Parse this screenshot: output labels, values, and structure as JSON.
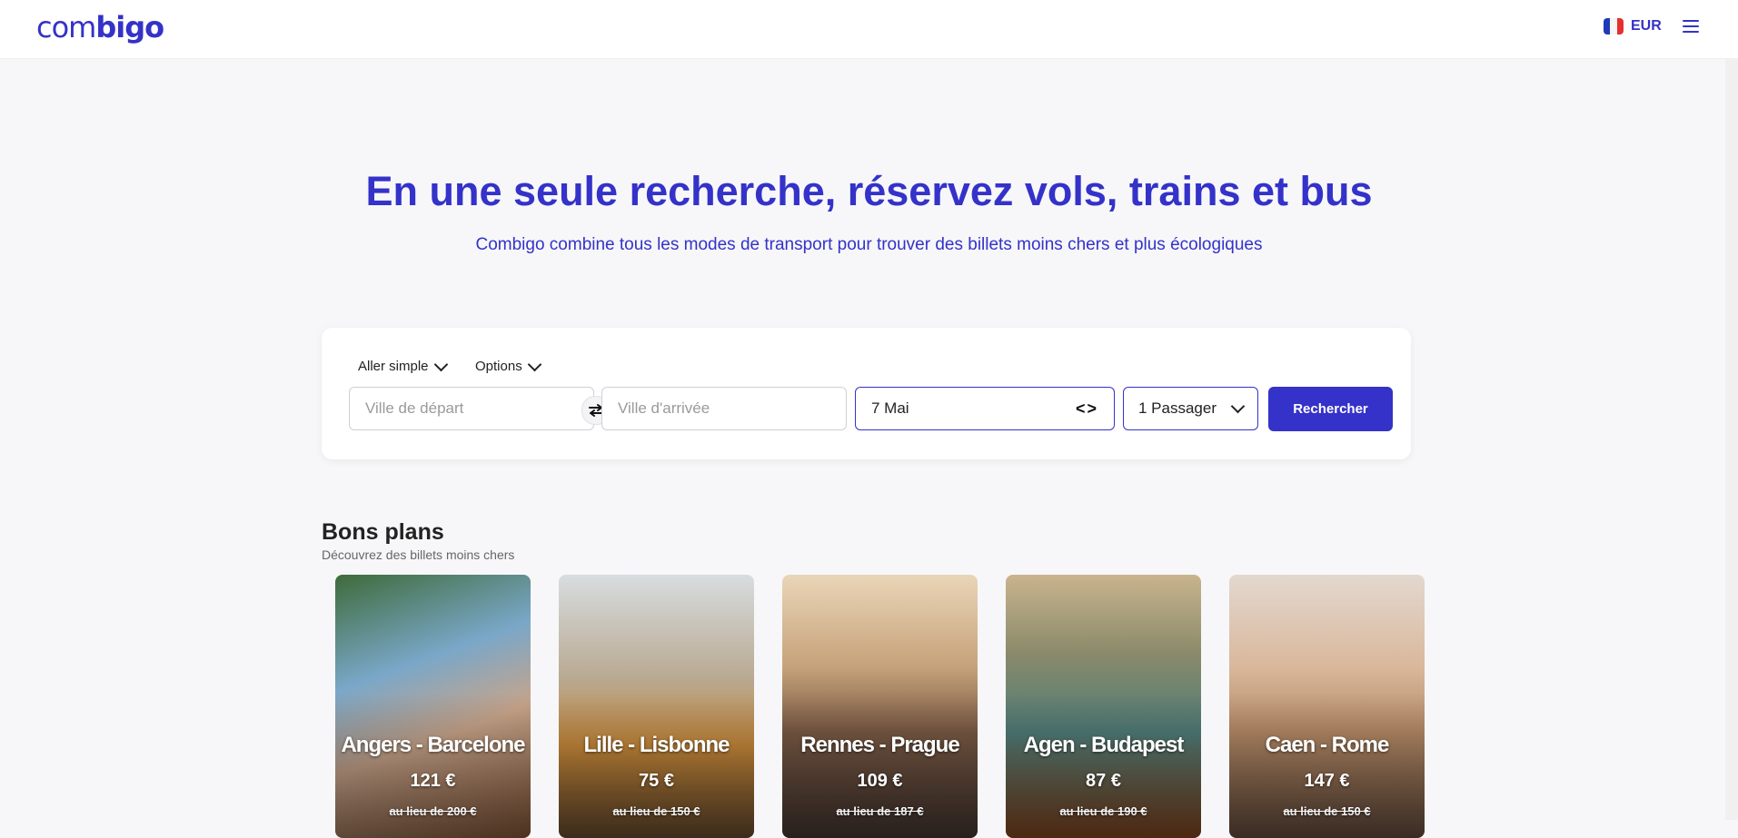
{
  "header": {
    "logo_light": "com",
    "logo_bold": "bigo",
    "currency": "EUR",
    "flag_icon": "france-flag-icon",
    "menu_icon": "hamburger-menu-icon"
  },
  "hero": {
    "title": "En une seule recherche, réservez vols, trains et bus",
    "subtitle": "Combigo combine tous les modes de transport pour trouver des billets moins chers et plus écologiques"
  },
  "search": {
    "trip_type": "Aller simple",
    "options_label": "Options",
    "departure_placeholder": "Ville de départ",
    "arrival_placeholder": "Ville d'arrivée",
    "date": "7 Mai",
    "date_arrows": "<>",
    "passengers": "1 Passager",
    "button_label": "Rechercher"
  },
  "deals": {
    "title": "Bons plans",
    "subtitle": "Découvrez des billets moins chers",
    "cards": [
      {
        "route": "Angers - Barcelone",
        "price": "121 €",
        "was": "au lieu de 200 €"
      },
      {
        "route": "Lille - Lisbonne",
        "price": "75 €",
        "was": "au lieu de 150 €"
      },
      {
        "route": "Rennes - Prague",
        "price": "109 €",
        "was": "au lieu de 187 €"
      },
      {
        "route": "Agen - Budapest",
        "price": "87 €",
        "was": "au lieu de 190 €"
      },
      {
        "route": "Caen - Rome",
        "price": "147 €",
        "was": "au lieu de 150 €"
      }
    ]
  },
  "colors": {
    "brand": "#3432c9",
    "background": "#f7f7f9"
  }
}
